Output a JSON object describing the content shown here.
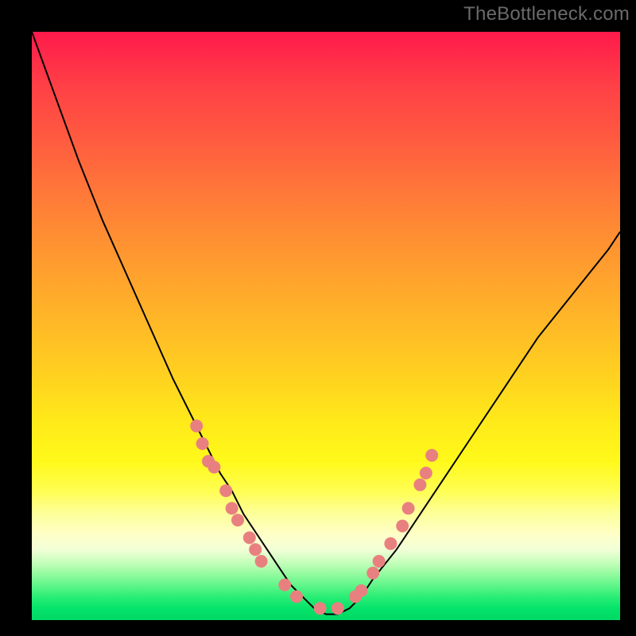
{
  "watermark": "TheBottleneck.com",
  "chart_data": {
    "type": "line",
    "title": "",
    "xlabel": "",
    "ylabel": "",
    "xlim": [
      0,
      100
    ],
    "ylim": [
      0,
      100
    ],
    "grid": false,
    "legend": false,
    "series": [
      {
        "name": "curve",
        "x": [
          0,
          4,
          8,
          12,
          16,
          20,
          24,
          26,
          28,
          30,
          32,
          34,
          36,
          38,
          40,
          42,
          44,
          46,
          48,
          50,
          52,
          54,
          56,
          58,
          62,
          66,
          70,
          74,
          78,
          82,
          86,
          90,
          94,
          98,
          100
        ],
        "y": [
          100,
          89,
          78,
          68,
          59,
          50,
          41,
          37,
          33,
          29,
          25,
          22,
          18,
          15,
          12,
          9,
          6,
          4,
          2,
          1,
          1,
          2,
          4,
          7,
          12,
          18,
          24,
          30,
          36,
          42,
          48,
          53,
          58,
          63,
          66
        ]
      }
    ],
    "data_points": {
      "left_branch": [
        [
          28,
          33
        ],
        [
          29,
          30
        ],
        [
          30,
          27
        ],
        [
          31,
          26
        ],
        [
          33,
          22
        ],
        [
          34,
          19
        ],
        [
          35,
          17
        ],
        [
          37,
          14
        ],
        [
          38,
          12
        ],
        [
          39,
          10
        ],
        [
          43,
          6
        ],
        [
          45,
          4
        ]
      ],
      "right_branch": [
        [
          49,
          2
        ],
        [
          52,
          2
        ],
        [
          55,
          4
        ],
        [
          56,
          5
        ],
        [
          58,
          8
        ],
        [
          59,
          10
        ],
        [
          61,
          13
        ],
        [
          63,
          16
        ],
        [
          64,
          19
        ],
        [
          66,
          23
        ],
        [
          67,
          25
        ],
        [
          68,
          28
        ]
      ]
    },
    "background_gradient": {
      "top": "#ff1a4b",
      "mid": "#ffe91a",
      "bottom": "#00d964"
    },
    "notes": "V-shaped bottleneck curve on a rainbow gradient. Salmon dots mark sampled points on both branches near the valley. Axes have no visible ticks or labels."
  }
}
